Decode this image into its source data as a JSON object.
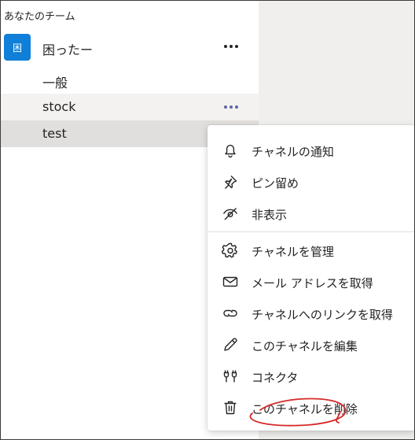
{
  "sidebar": {
    "section_header": "あなたのチーム",
    "team": {
      "avatar_text": "困",
      "name": "困ったー"
    },
    "channels": [
      {
        "label": "一般"
      },
      {
        "label": "stock"
      },
      {
        "label": "test"
      }
    ]
  },
  "context_menu": {
    "items": [
      {
        "label": "チャネルの通知",
        "icon": "bell-icon"
      },
      {
        "label": "ピン留め",
        "icon": "pin-icon"
      },
      {
        "label": "非表示",
        "icon": "eye-off-icon"
      },
      {
        "label": "チャネルを管理",
        "icon": "gear-icon"
      },
      {
        "label": "メール アドレスを取得",
        "icon": "mail-icon"
      },
      {
        "label": "チャネルへのリンクを取得",
        "icon": "link-icon"
      },
      {
        "label": "このチャネルを編集",
        "icon": "pencil-icon"
      },
      {
        "label": "コネクタ",
        "icon": "connector-icon"
      },
      {
        "label": "このチャネルを削除",
        "icon": "trash-icon"
      }
    ]
  },
  "colors": {
    "accent": "#6264a7",
    "avatar": "#0f7fd9",
    "annotation": "#d62a2a",
    "right_pane": "#f0efee"
  }
}
